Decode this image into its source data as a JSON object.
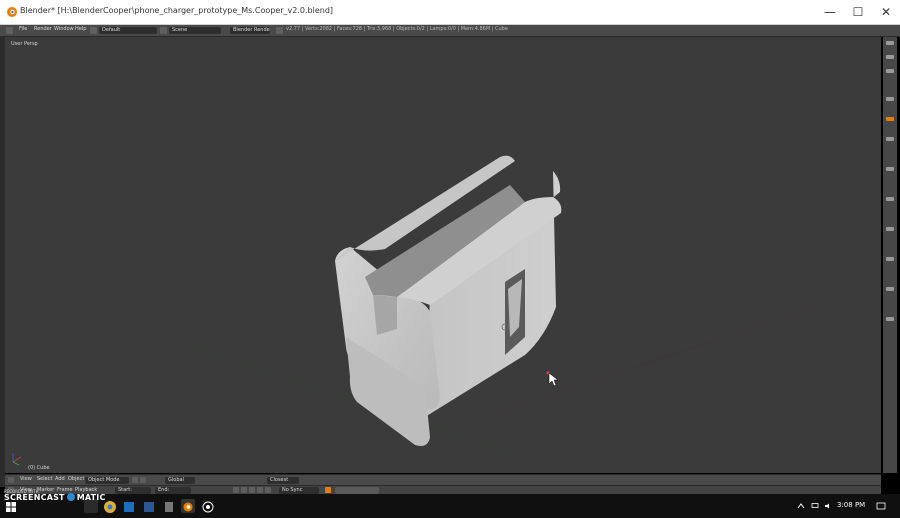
{
  "window": {
    "title": "Blender* [H:\\BlenderCooper\\phone_charger_prototype_Ms.Cooper_v2.0.blend]",
    "minimize": "—",
    "maximize": "☐",
    "close": "✕"
  },
  "menu": {
    "items": [
      "File",
      "Render",
      "Window",
      "Help"
    ],
    "layout": "Default",
    "scene": "Scene",
    "engine": "Blender Render",
    "stats": "v2.77 | Verts:2082 | Faces:728 | Tris:3,968 | Objects:0/2 | Lamps:0/0 | Mem:4.86M | Cube"
  },
  "viewport": {
    "label": "User Persp",
    "object_label": "(0) Cube"
  },
  "view3d_header": {
    "items": [
      "View",
      "Select",
      "Add",
      "Object"
    ],
    "mode": "Object Mode",
    "shading": "Global",
    "proportional": "Closest"
  },
  "timeline": {
    "items": [
      "View",
      "Marker",
      "Frame",
      "Playback"
    ],
    "start": "Start:",
    "end": "End:",
    "sync": "No Sync"
  },
  "watermark": {
    "small": "RECORDED WITH",
    "main_left": "SCREENCAST",
    "main_right": "MATIC"
  },
  "taskbar": {
    "time": "3:08 PM"
  },
  "colors": {
    "viewport_bg": "#3b3b3b",
    "model": "#c8c8c8",
    "accent": "#e87d0d"
  }
}
